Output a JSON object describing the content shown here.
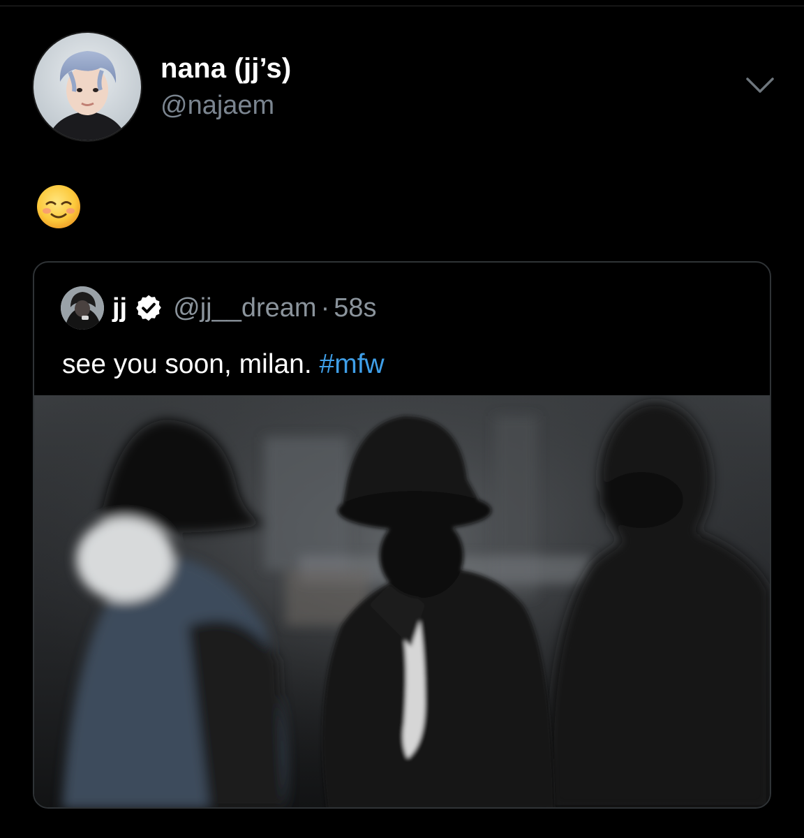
{
  "tweet": {
    "author": {
      "display_name": "nana (jj’s)",
      "handle": "@najaem",
      "avatar_icon": "profile-photo-blue-hair"
    },
    "menu_icon": "chevron-down-icon",
    "body_emoji": "☺️",
    "body_emoji_icon": "smiling-face-emoji",
    "quoted": {
      "display_name": "jj",
      "verified": true,
      "handle": "@jj__dream",
      "separator": "·",
      "time": "58s",
      "text_main": "see you soon, milan. ",
      "hashtag": "#mfw",
      "media": "photo-person-bucket-hat-airport"
    }
  },
  "colors": {
    "background": "#000000",
    "secondary_text": "#7b8590",
    "hashtag": "#3f9fe8",
    "card_border": "#2f3336",
    "verified_badge": "#ffffff"
  }
}
